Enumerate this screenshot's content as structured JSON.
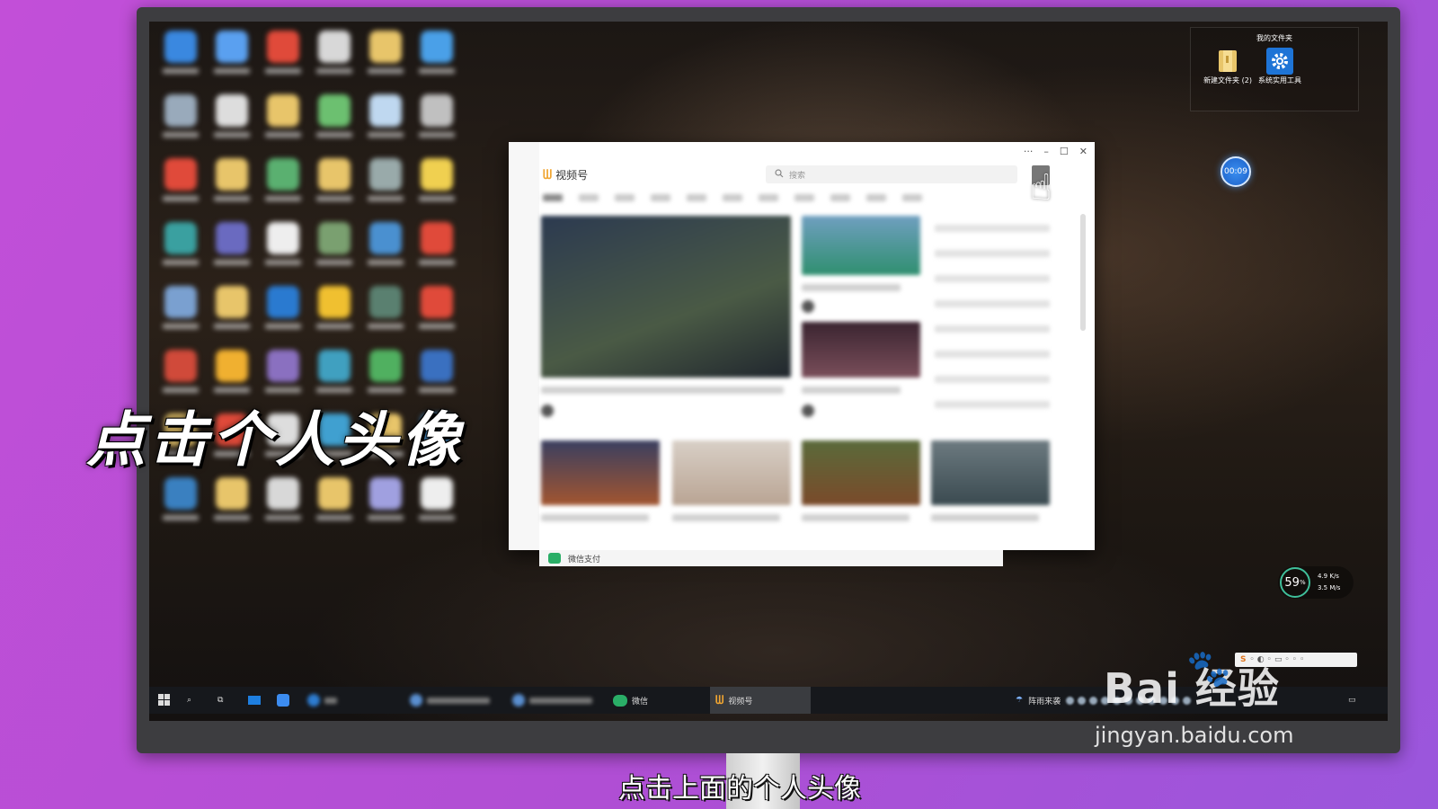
{
  "desktop": {
    "folder_widget": {
      "title": "我的文件夹",
      "items": [
        {
          "label": "新建文件夹 (2)",
          "icon": "folder-icon"
        },
        {
          "label": "系统实用工具",
          "icon": "gear-icon"
        }
      ]
    },
    "timer": "00:09",
    "network": {
      "percent": "59",
      "unit": "%",
      "up": "4.9 K/s",
      "down": "3.5 M/s"
    },
    "ime_label": "S"
  },
  "window": {
    "app_name": "视频号",
    "search_placeholder": "搜索",
    "controls": {
      "more": "···",
      "minimize": "–",
      "maximize": "☐",
      "close": "✕"
    },
    "bottom_bar_label": "微信支付"
  },
  "taskbar": {
    "wechat_label": "微信",
    "active_label": "视频号",
    "weather": "阵雨来袭"
  },
  "overlay": {
    "big_caption": "点击个人头像",
    "subtitle": "点击上面的个人头像",
    "watermark_brand": "Bai  经验",
    "watermark_url": "jingyan.baidu.com"
  },
  "colors": {
    "background": "#b04ed4",
    "accent_logo": "#f0a531",
    "wechat_green": "#2aae67",
    "timer_blue": "#2f7fe6"
  }
}
